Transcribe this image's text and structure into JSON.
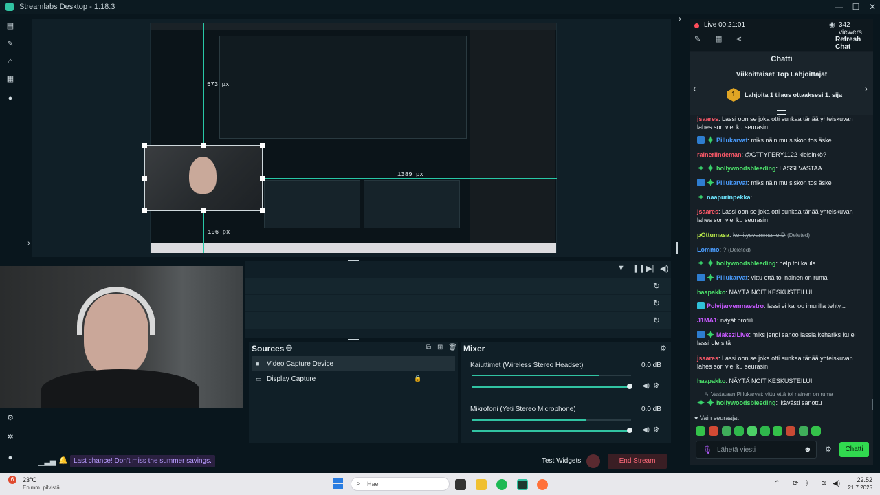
{
  "window": {
    "title": "Streamlabs Desktop - 1.18.3"
  },
  "measures": {
    "top": "573 px",
    "right": "1389 px",
    "bottom": "196 px"
  },
  "sources": {
    "title": "Sources",
    "items": [
      {
        "label": "Video Capture Device",
        "icon": "camera-icon"
      },
      {
        "label": "Display Capture",
        "icon": "monitor-icon"
      }
    ]
  },
  "mixer": {
    "title": "Mixer",
    "channels": [
      {
        "label": "Kaiuttimet (Wireless Stereo Headset)",
        "db": "0.0 dB",
        "level": 0.8,
        "volume": 1.0
      },
      {
        "label": "Mikrofoni (Yeti Stereo Microphone)",
        "db": "0.0 dB",
        "level": 0.72,
        "volume": 1.0
      }
    ]
  },
  "footer": {
    "promo": "Last chance! Don't miss the summer savings.",
    "test_widgets": "Test Widgets",
    "end_stream": "End Stream"
  },
  "chat": {
    "live": "Live 00:21:01",
    "viewers": "342 viewers",
    "refresh": "Refresh Chat",
    "header": "Chatti",
    "top_title": "Viikoittaiset Top Lahjoittajat",
    "top_rank": "1",
    "top_cta": "Lahjoita 1 tilaus ottaaksesi 1. sija",
    "messages": [
      {
        "badges": [],
        "user": "jsaares",
        "color": "#ff5a6a",
        "text": "Lassi oon se joka otti sunkaa tänää yhteiskuvan lahes sori viel ku seurasin"
      },
      {
        "badges": [
          "twitch",
          "green"
        ],
        "user": "Pillukarvat",
        "color": "#4a9dff",
        "text": "miks näin mu siskon tos äske"
      },
      {
        "badges": [],
        "user": "rainerlindeman",
        "color": "#ff5a6a",
        "text": "@GTFYFERY1122 kielsinkö?"
      },
      {
        "badges": [
          "green",
          "green"
        ],
        "user": "hollywoodsbleeding",
        "color": "#4ce16a",
        "text": "LASSI VASTAA"
      },
      {
        "badges": [
          "twitch",
          "green"
        ],
        "user": "Pillukarvat",
        "color": "#4a9dff",
        "text": "miks näin mu siskon tos äske"
      },
      {
        "badges": [
          "green"
        ],
        "user": "naapurinpekka",
        "color": "#6ee6ff",
        "text": "..."
      },
      {
        "badges": [],
        "user": "jsaares",
        "color": "#ff5a6a",
        "text": "Lassi oon se joka otti sunkaa tänää yhteiskuvan lahes sori viel ku seurasin"
      },
      {
        "badges": [],
        "user": "pOttumasa",
        "color": "#b8e84a",
        "text": "kehitysvammane:D",
        "suffix": "(Deleted)"
      },
      {
        "badges": [],
        "user": "Lommo",
        "color": "#4a9dff",
        "text": "?",
        "suffix": "(Deleted)"
      },
      {
        "badges": [
          "green",
          "green"
        ],
        "user": "hollywoodsbleeding",
        "color": "#4ce16a",
        "text": "help toi kaula"
      },
      {
        "badges": [
          "twitch",
          "green"
        ],
        "user": "Pillukarvat",
        "color": "#4a9dff",
        "text": "vittu että toi nainen on ruma"
      },
      {
        "badges": [],
        "user": "haapakko",
        "color": "#4ce16a",
        "text": "NÄYTÄ NOIT KESKUSTEILUI"
      },
      {
        "badges": [
          "cyan"
        ],
        "user": "Polvijarvenmaestro",
        "color": "#c85aff",
        "text": "lassi ei kai oo imurilla tehty..."
      },
      {
        "badges": [],
        "user": "J1MA1",
        "color": "#c85aff",
        "text": "näyät profiili"
      },
      {
        "badges": [
          "twitch",
          "green"
        ],
        "user": "MakeziLive",
        "color": "#c85aff",
        "text": "miks jengi sanoo lassia kehariks ku ei lassi ole sitä"
      },
      {
        "badges": [],
        "user": "jsaares",
        "color": "#ff5a6a",
        "text": "Lassi oon se joka otti sunkaa tänää yhteiskuvan lahes sori viel ku seurasin"
      },
      {
        "badges": [],
        "user": "haapakko",
        "color": "#4ce16a",
        "text": "NÄYTÄ NOIT KESKUSTEILUI"
      }
    ],
    "reply_hint": "Vastataan Pillukarvat: vittu että toi nainen on ruma",
    "reply": {
      "badges": [
        "green",
        "green"
      ],
      "user": "hollywoodsbleeding",
      "color": "#4ce16a",
      "text": "ikävästi sanottu"
    },
    "followers_only": "Vain seuraajat",
    "input_placeholder": "Lähetä viesti",
    "send": "Chatti"
  },
  "taskbar": {
    "weather_temp": "23°C",
    "weather_desc": "Enimm. pilvistä",
    "weather_badge": "6",
    "search_placeholder": "Hae",
    "time": "22.52",
    "date": "21.7.2025"
  },
  "colors": {
    "accent": "#31c3a2",
    "live": "#ff4d5a",
    "send_button": "#31d94f"
  }
}
